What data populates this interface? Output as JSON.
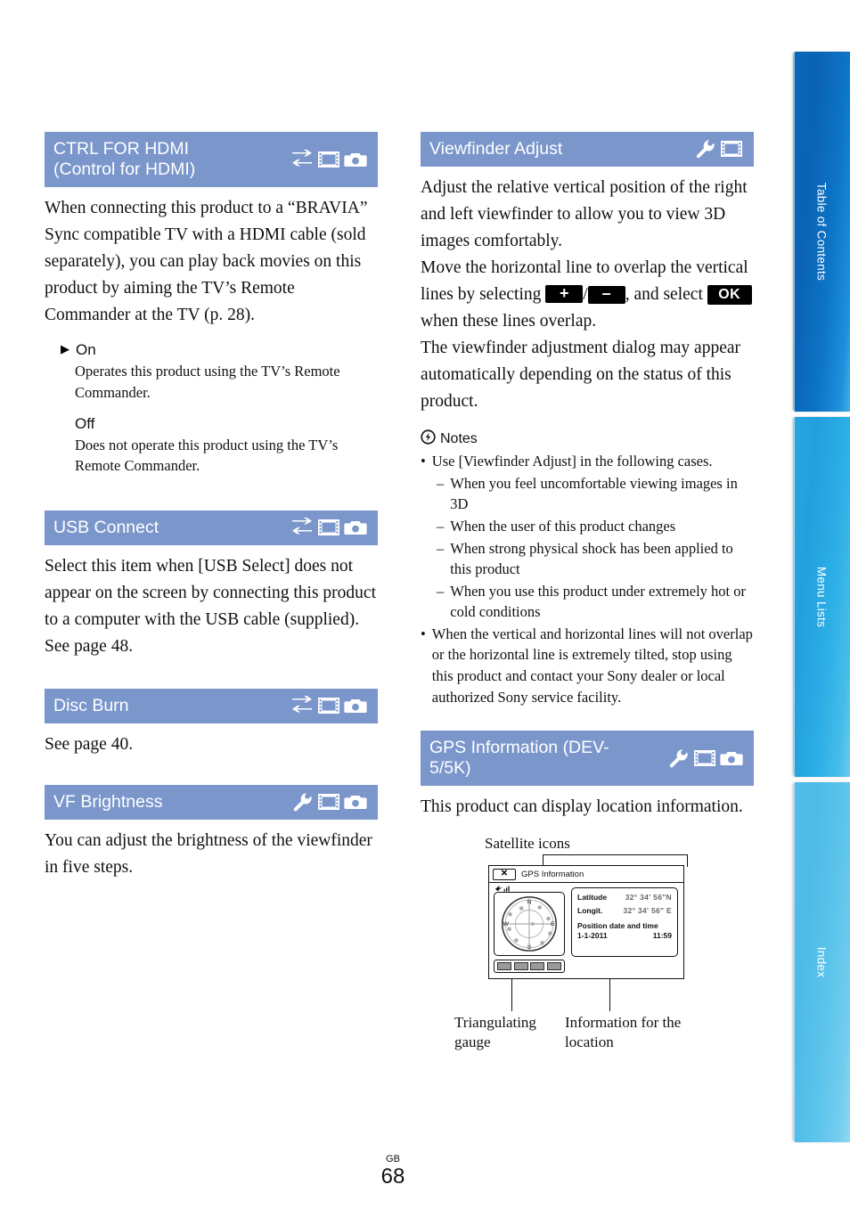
{
  "side_tabs": [
    {
      "label": "Table of Contents",
      "color": "#0b66bb"
    },
    {
      "label": "Menu Lists",
      "color": "#2aa5e0"
    },
    {
      "label": "Index",
      "color": "#54bde9"
    }
  ],
  "theme": {
    "section_header_bg": "#7a96cb",
    "section_header_text": "#ffffff",
    "body_text": "#101010"
  },
  "left_column": {
    "ctrl_hdmi": {
      "title_line1": "CTRL FOR HDMI",
      "title_line2": "(Control for HDMI)",
      "icons": [
        "transfer-icon",
        "movie-icon",
        "photo-icon"
      ],
      "body": "When connecting this product to a “BRAVIA” Sync compatible TV with a HDMI cable (sold separately), you can play back movies on this product by aiming the TV’s Remote Commander at the TV (p. 28).",
      "options": [
        {
          "arrow": "▶",
          "name": "On",
          "desc": "Operates this product using the TV’s Remote Commander."
        },
        {
          "arrow": "",
          "name": "Off",
          "desc": "Does not operate this product using the TV’s Remote Commander."
        }
      ]
    },
    "usb_connect": {
      "title": "USB Connect",
      "icons": [
        "transfer-icon",
        "movie-icon",
        "photo-icon"
      ],
      "body": "Select this item when [USB Select] does not appear on the screen by connecting this product to a computer with the USB cable (supplied).",
      "body2": "See page 48."
    },
    "disc_burn": {
      "title": "Disc Burn",
      "icons": [
        "transfer-icon",
        "movie-icon",
        "photo-icon"
      ],
      "body": "See page 40."
    },
    "vf_brightness": {
      "title": "VF Brightness",
      "icons": [
        "wrench-icon",
        "movie-icon",
        "photo-icon"
      ],
      "body": "You can adjust the brightness of the viewfinder in five steps."
    }
  },
  "right_column": {
    "viewfinder_adjust": {
      "title": "Viewfinder Adjust",
      "icons": [
        "wrench-icon",
        "movie-icon"
      ],
      "para1": "Adjust the relative vertical position of the right and left viewfinder to allow you to view 3D images comfortably.",
      "para2_a": "Move the horizontal line to overlap the vertical lines by selecting ",
      "key_plus": "+",
      "para2_sep": "/",
      "key_minus": "–",
      "para2_b": ", and select ",
      "key_ok": "OK",
      "para2_c": " when these lines overlap.",
      "para3": "The viewfinder adjustment dialog may appear automatically depending on the status of this product.",
      "notes_label": "Notes",
      "notes": [
        {
          "type": "bullet",
          "text": "Use [Viewfinder Adjust] in the following cases."
        },
        {
          "type": "sub",
          "text": "When you feel uncomfortable viewing images in 3D"
        },
        {
          "type": "sub",
          "text": "When the user of this product changes"
        },
        {
          "type": "sub",
          "text": "When strong physical shock has been applied to this product"
        },
        {
          "type": "sub",
          "text": "When you use this product under extremely hot or cold conditions"
        },
        {
          "type": "bullet",
          "text": "When the vertical and horizontal lines will not overlap or the horizontal line is extremely tilted, stop using this product and contact your Sony dealer or local authorized Sony service facility."
        }
      ]
    },
    "gps_information": {
      "title_line1": "GPS Information (DEV-",
      "title_line2": "5/5K)",
      "icons": [
        "wrench-icon",
        "movie-icon",
        "photo-icon"
      ],
      "body": "This product can display location information.",
      "figure": {
        "caption_top": "Satellite icons",
        "caption_left": "Triangulating gauge",
        "caption_right": "Information for the location",
        "screen": {
          "close_label": "✕",
          "window_title": "GPS Information",
          "latitude_label": "Latitude",
          "latitude_value": "32° 34' 56\"N",
          "longitude_label": "Longit.",
          "longitude_value": "32° 34' 56\" E",
          "position_label": "Position date and time",
          "date": "1-1-2011",
          "time": "11:59",
          "compass": {
            "n": "N",
            "e": "E",
            "s": "S",
            "w": "W"
          }
        }
      }
    }
  },
  "footer": {
    "region": "GB",
    "page_number": "68"
  }
}
